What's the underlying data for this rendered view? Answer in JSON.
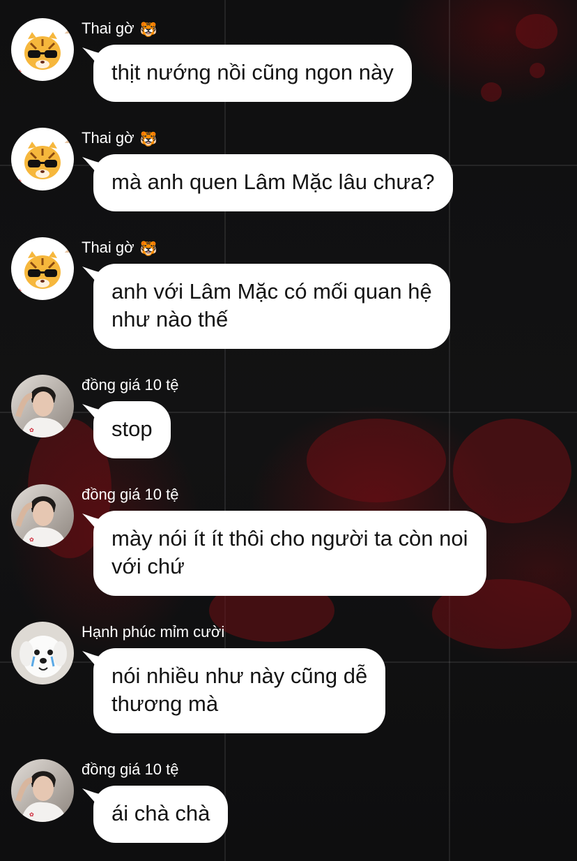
{
  "messages": [
    {
      "sender": "Thai gờ",
      "sender_emoji": "🐯",
      "avatar": "tiger-sunglasses-avatar",
      "lines": [
        "thịt nướng nồi cũng ngon này"
      ]
    },
    {
      "sender": "Thai gờ",
      "sender_emoji": "🐯",
      "avatar": "tiger-sunglasses-avatar",
      "lines": [
        "mà anh quen Lâm Mặc lâu chưa?"
      ]
    },
    {
      "sender": "Thai gờ",
      "sender_emoji": "🐯",
      "avatar": "tiger-sunglasses-avatar",
      "lines": [
        "anh với Lâm Mặc có mối quan hệ",
        "như nào thế"
      ]
    },
    {
      "sender": "đồng giá 10 tệ",
      "sender_emoji": "",
      "avatar": "young-man-avatar",
      "lines": [
        "stop"
      ]
    },
    {
      "sender": "đồng giá 10 tệ",
      "sender_emoji": "",
      "avatar": "young-man-avatar",
      "lines": [
        "mày nói ít ít thôi cho người ta còn noi",
        "với chứ"
      ]
    },
    {
      "sender": "Hạnh phúc mỉm cười",
      "sender_emoji": "",
      "avatar": "white-puppy-avatar",
      "lines": [
        "nói nhiều như này cũng dễ",
        "thương mà"
      ]
    },
    {
      "sender": "đồng giá 10 tệ",
      "sender_emoji": "",
      "avatar": "young-man-avatar",
      "lines": [
        "ái chà chà"
      ]
    }
  ],
  "colors": {
    "background": "#0d0d0e",
    "bubble": "#ffffff",
    "bubble_text": "#141414",
    "sender_text": "#ffffff",
    "paint_accent": "#6e0f14"
  }
}
